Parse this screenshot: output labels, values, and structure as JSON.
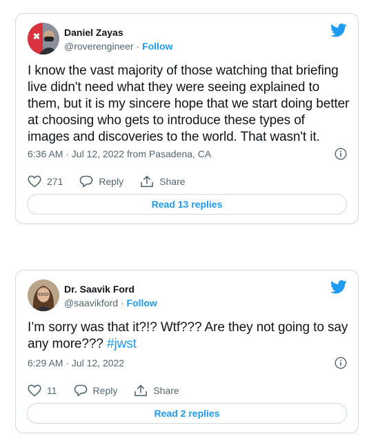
{
  "colors": {
    "accent": "#1d9bf0",
    "text": "#0f1419",
    "muted": "#536471",
    "border": "#cfd9de"
  },
  "tweets": [
    {
      "name": "Daniel Zayas",
      "handle": "@roverengineer",
      "separator": " · ",
      "follow_label": "Follow",
      "text": "I know the vast majority of those watching that briefing live didn't need what they were seeing explained to them, but it is my sincere hope that we start doing better at choosing who gets to  introduce these types of images and discoveries to the world.  That wasn't it.",
      "hashtag": "",
      "timestamp": "6:36 AM · Jul 12, 2022 from Pasadena, CA",
      "like_count": "271",
      "reply_label": "Reply",
      "share_label": "Share",
      "replies_button": "Read 13 replies",
      "icons": [
        "avatar",
        "twitter-bird-icon",
        "info-icon",
        "heart-icon",
        "reply-icon",
        "share-icon"
      ]
    },
    {
      "name": "Dr. Saavik Ford",
      "handle": "@saavikford",
      "separator": " · ",
      "follow_label": "Follow",
      "text": "I’m sorry was that it?!? Wtf??? Are they not going to say any more??? ",
      "hashtag": "#jwst",
      "timestamp": "6:29 AM · Jul 12, 2022",
      "like_count": "11",
      "reply_label": "Reply",
      "share_label": "Share",
      "replies_button": "Read 2 replies",
      "icons": [
        "avatar",
        "twitter-bird-icon",
        "info-icon",
        "heart-icon",
        "reply-icon",
        "share-icon"
      ]
    }
  ]
}
